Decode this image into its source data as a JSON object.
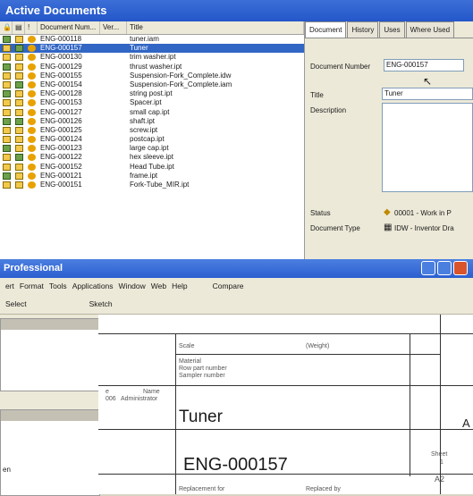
{
  "top_window": {
    "title": "Active Documents",
    "columns": [
      "Document Num...",
      "Ver...",
      "Title"
    ],
    "rows": [
      {
        "num": "ENG-000118",
        "title": "tuner.iam",
        "selected": false
      },
      {
        "num": "ENG-000157",
        "title": "Tuner",
        "selected": true
      },
      {
        "num": "ENG-000130",
        "title": "trim washer.ipt",
        "selected": false
      },
      {
        "num": "ENG-000129",
        "title": "thrust washer.ipt",
        "selected": false
      },
      {
        "num": "ENG-000155",
        "title": "Suspension-Fork_Complete.idw",
        "selected": false
      },
      {
        "num": "ENG-000154",
        "title": "Suspension-Fork_Complete.iam",
        "selected": false
      },
      {
        "num": "ENG-000128",
        "title": "string post.ipt",
        "selected": false
      },
      {
        "num": "ENG-000153",
        "title": "Spacer.ipt",
        "selected": false
      },
      {
        "num": "ENG-000127",
        "title": "small cap.ipt",
        "selected": false
      },
      {
        "num": "ENG-000126",
        "title": "shaft.ipt",
        "selected": false
      },
      {
        "num": "ENG-000125",
        "title": "screw.ipt",
        "selected": false
      },
      {
        "num": "ENG-000124",
        "title": "postcap.ipt",
        "selected": false
      },
      {
        "num": "ENG-000123",
        "title": "large cap.ipt",
        "selected": false
      },
      {
        "num": "ENG-000122",
        "title": "hex sleeve.ipt",
        "selected": false
      },
      {
        "num": "ENG-000152",
        "title": "Head Tube.ipt",
        "selected": false
      },
      {
        "num": "ENG-000121",
        "title": "frame.ipt",
        "selected": false
      },
      {
        "num": "ENG-000151",
        "title": "Fork-Tube_MIR.ipt",
        "selected": false
      }
    ],
    "tabs": [
      "Document",
      "History",
      "Uses",
      "Where Used"
    ],
    "doc_number_label": "Document Number",
    "doc_number_value": "ENG-000157",
    "title_label": "Title",
    "title_value": "Tuner",
    "description_label": "Description",
    "status_label": "Status",
    "status_value": "00001 - Work in P",
    "doctype_label": "Document Type",
    "doctype_value": "IDW - Inventor Dra"
  },
  "bottom_window": {
    "title": "Professional",
    "menu": [
      "ert",
      "Format",
      "Tools",
      "Applications",
      "Window",
      "Web",
      "Help",
      "Compare"
    ],
    "toolbar": [
      "Select",
      "Sketch"
    ],
    "title_block": {
      "scale": "Scale",
      "weight": "(Weight)",
      "material": "Material",
      "row_part": "Row part number",
      "sampler": "Sampler number",
      "e": "e",
      "name": "Name",
      "admin": "Administrator",
      "date": "006",
      "drawing_title": "Tuner",
      "drawing_number": "ENG-000157",
      "sheet": "Sheet",
      "sheet_no": "1",
      "size": "A2",
      "side_letter": "A",
      "replacement_for": "Replacement for",
      "replaced_by": "Replaced by",
      "left_fragment": "en"
    }
  }
}
